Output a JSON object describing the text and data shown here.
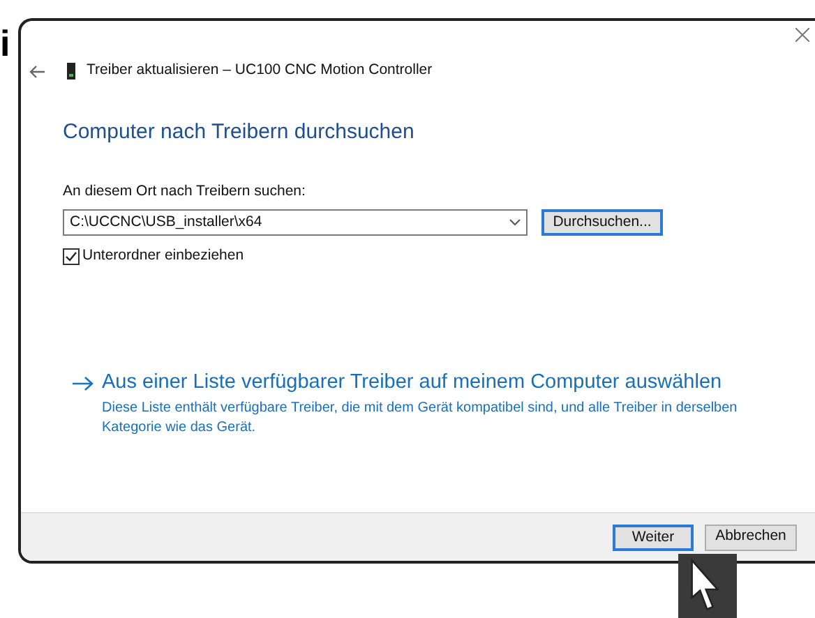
{
  "background_text": "i",
  "dialog": {
    "title": "Treiber aktualisieren – UC100 CNC Motion Controller",
    "heading": "Computer nach Treibern durchsuchen",
    "path_label": "An diesem Ort nach Treibern suchen:",
    "path_value": "C:\\UCCNC\\USB_installer\\x64",
    "browse_button": "Durchsuchen...",
    "include_subfolders": {
      "label": "Unterordner einbeziehen",
      "checked": true
    },
    "pick_link": {
      "title": "Aus einer Liste verfügbarer Treiber auf meinem Computer auswählen",
      "description": "Diese Liste enthält verfügbare Treiber, die mit dem Gerät kompatibel sind, und alle Treiber in derselben Kategorie wie das Gerät."
    },
    "buttons": [
      {
        "label": "Weiter",
        "default": true
      },
      {
        "label": "Abbrechen",
        "default": false
      }
    ]
  }
}
